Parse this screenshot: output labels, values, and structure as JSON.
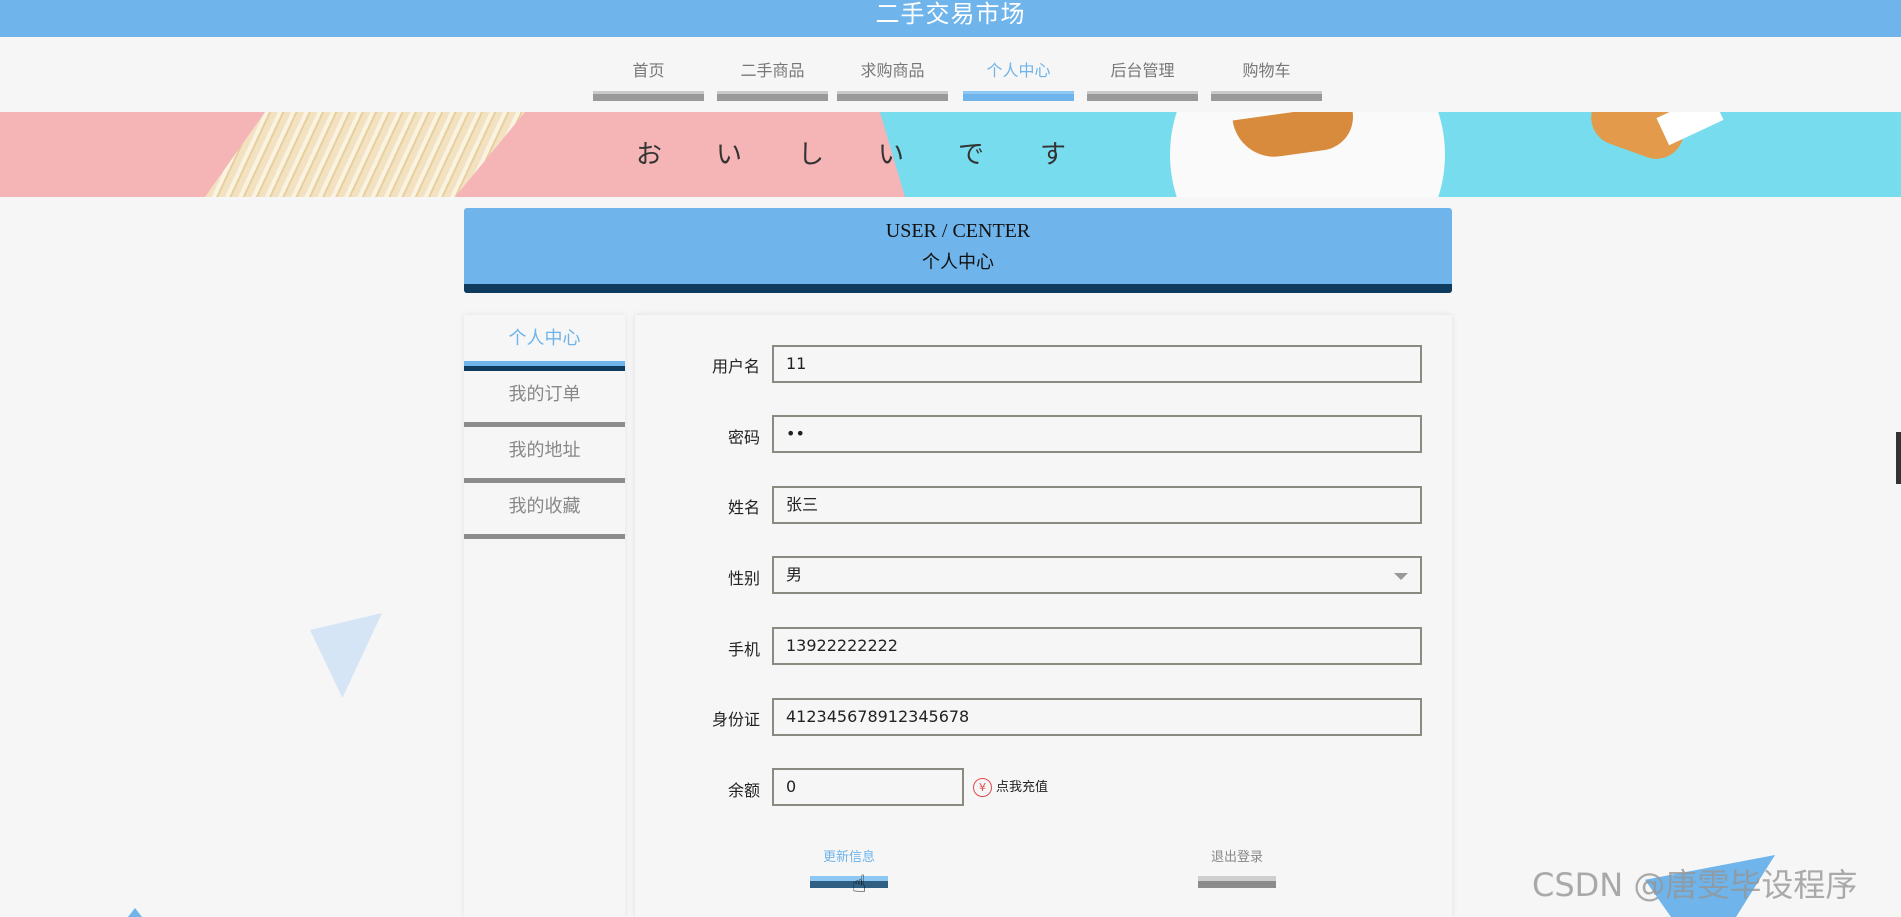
{
  "site": {
    "title": "二手交易市场"
  },
  "nav": {
    "items": [
      {
        "label": "首页",
        "active": false
      },
      {
        "label": "二手商品",
        "active": false
      },
      {
        "label": "求购商品",
        "active": false
      },
      {
        "label": "个人中心",
        "active": true
      },
      {
        "label": "后台管理",
        "active": false
      },
      {
        "label": "购物车",
        "active": false
      }
    ]
  },
  "banner": {
    "chars": [
      "お",
      "い",
      "し",
      "い",
      "で",
      "す"
    ]
  },
  "section": {
    "title_en": "USER / CENTER",
    "title_cn": "个人中心"
  },
  "sidebar": {
    "items": [
      {
        "label": "个人中心",
        "active": true
      },
      {
        "label": "我的订单",
        "active": false
      },
      {
        "label": "我的地址",
        "active": false
      },
      {
        "label": "我的收藏",
        "active": false
      }
    ]
  },
  "form": {
    "username": {
      "label": "用户名",
      "value": "11"
    },
    "password": {
      "label": "密码",
      "value": "••"
    },
    "name": {
      "label": "姓名",
      "value": "张三"
    },
    "gender": {
      "label": "性别",
      "value": "男"
    },
    "phone": {
      "label": "手机",
      "value": "13922222222"
    },
    "id_card": {
      "label": "身份证",
      "value": "412345678912345678"
    },
    "balance": {
      "label": "余额",
      "value": "0"
    },
    "recharge_label": "点我充值",
    "recharge_symbol": "¥",
    "update_label": "更新信息",
    "logout_label": "退出登录"
  },
  "watermark": "CSDN @唐雯毕设程序",
  "colors": {
    "primary": "#6fb4ea",
    "dark": "#0f3b5f",
    "gray_bar": "#8c8c8c"
  }
}
